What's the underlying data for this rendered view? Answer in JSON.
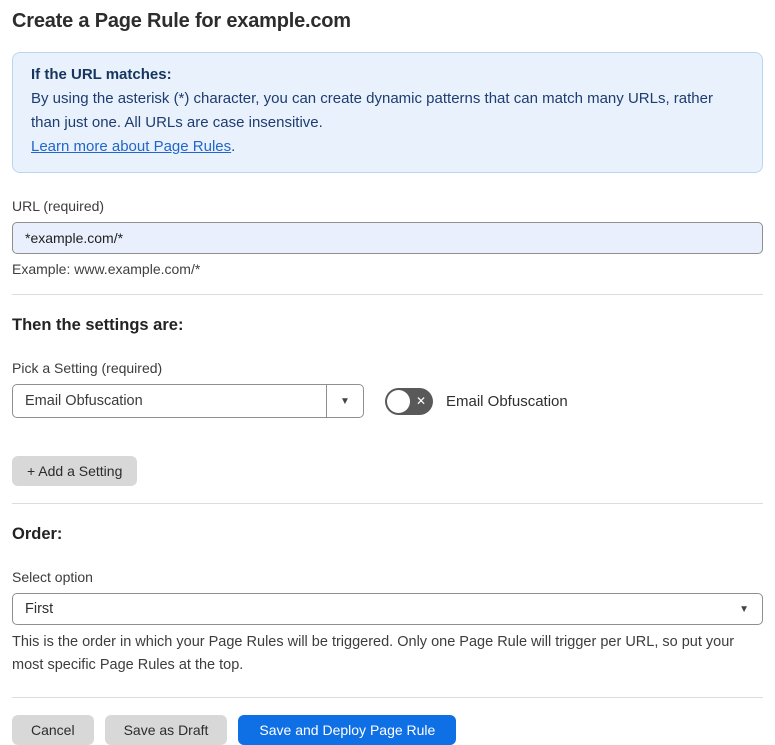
{
  "page": {
    "title": "Create a Page Rule for example.com"
  },
  "info_box": {
    "heading": "If the URL matches:",
    "body": "By using the asterisk (*) character, you can create dynamic patterns that can match many URLs, rather than just one. All URLs are case insensitive.",
    "link_label": "Learn more about Page Rules",
    "link_suffix": "."
  },
  "url_field": {
    "label": "URL (required)",
    "value": "*example.com/*",
    "example": "Example: www.example.com/*"
  },
  "settings_section": {
    "heading": "Then the settings are:",
    "picker_label": "Pick a Setting (required)",
    "picker_value": "Email Obfuscation",
    "toggle_state": "off",
    "toggle_label": "Email Obfuscation",
    "add_setting_label": "+ Add a Setting"
  },
  "order_section": {
    "heading": "Order:",
    "select_label": "Select option",
    "select_value": "First",
    "help_text": "This is the order in which your Page Rules will be triggered. Only one Page Rule will trigger per URL, so put your most specific Page Rules at the top."
  },
  "footer": {
    "cancel_label": "Cancel",
    "save_draft_label": "Save as Draft",
    "save_deploy_label": "Save and Deploy Page Rule"
  },
  "icons": {
    "dropdown_caret": "▼",
    "select_caret": "▼",
    "toggle_off_glyph": "✕"
  },
  "colors": {
    "primary_button": "#0f6fe5",
    "info_bg": "#e9f2fc",
    "info_border": "#b9d6f0",
    "info_text": "#1e3c70",
    "link": "#2265cc",
    "url_input_bg": "#e9effc",
    "toggle_off_bg": "#595959",
    "gray_button_bg": "#d8d8d8"
  }
}
